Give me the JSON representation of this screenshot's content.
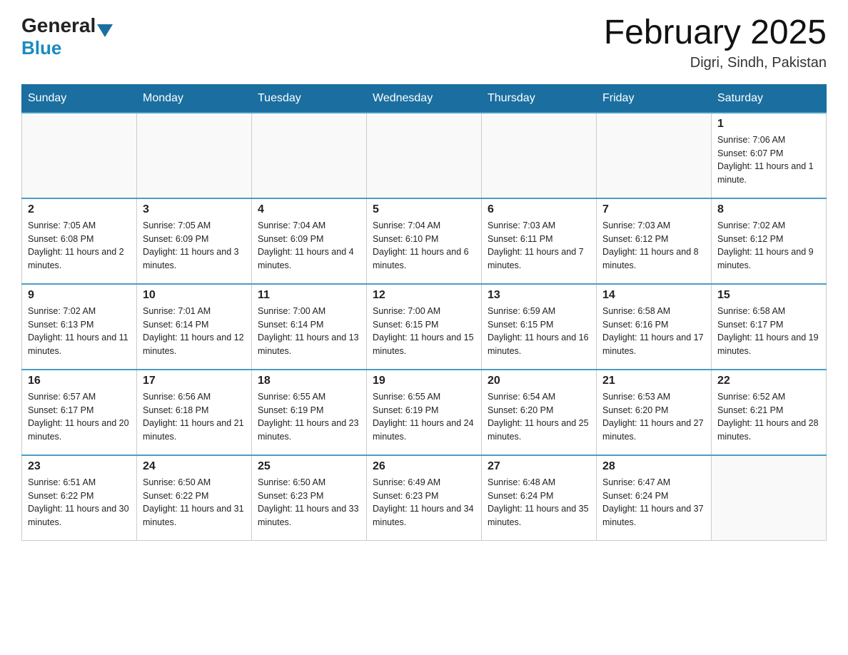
{
  "header": {
    "logo_general": "General",
    "logo_blue": "Blue",
    "month_title": "February 2025",
    "location": "Digri, Sindh, Pakistan"
  },
  "days_of_week": [
    "Sunday",
    "Monday",
    "Tuesday",
    "Wednesday",
    "Thursday",
    "Friday",
    "Saturday"
  ],
  "weeks": [
    [
      {
        "day": "",
        "info": ""
      },
      {
        "day": "",
        "info": ""
      },
      {
        "day": "",
        "info": ""
      },
      {
        "day": "",
        "info": ""
      },
      {
        "day": "",
        "info": ""
      },
      {
        "day": "",
        "info": ""
      },
      {
        "day": "1",
        "info": "Sunrise: 7:06 AM\nSunset: 6:07 PM\nDaylight: 11 hours and 1 minute."
      }
    ],
    [
      {
        "day": "2",
        "info": "Sunrise: 7:05 AM\nSunset: 6:08 PM\nDaylight: 11 hours and 2 minutes."
      },
      {
        "day": "3",
        "info": "Sunrise: 7:05 AM\nSunset: 6:09 PM\nDaylight: 11 hours and 3 minutes."
      },
      {
        "day": "4",
        "info": "Sunrise: 7:04 AM\nSunset: 6:09 PM\nDaylight: 11 hours and 4 minutes."
      },
      {
        "day": "5",
        "info": "Sunrise: 7:04 AM\nSunset: 6:10 PM\nDaylight: 11 hours and 6 minutes."
      },
      {
        "day": "6",
        "info": "Sunrise: 7:03 AM\nSunset: 6:11 PM\nDaylight: 11 hours and 7 minutes."
      },
      {
        "day": "7",
        "info": "Sunrise: 7:03 AM\nSunset: 6:12 PM\nDaylight: 11 hours and 8 minutes."
      },
      {
        "day": "8",
        "info": "Sunrise: 7:02 AM\nSunset: 6:12 PM\nDaylight: 11 hours and 9 minutes."
      }
    ],
    [
      {
        "day": "9",
        "info": "Sunrise: 7:02 AM\nSunset: 6:13 PM\nDaylight: 11 hours and 11 minutes."
      },
      {
        "day": "10",
        "info": "Sunrise: 7:01 AM\nSunset: 6:14 PM\nDaylight: 11 hours and 12 minutes."
      },
      {
        "day": "11",
        "info": "Sunrise: 7:00 AM\nSunset: 6:14 PM\nDaylight: 11 hours and 13 minutes."
      },
      {
        "day": "12",
        "info": "Sunrise: 7:00 AM\nSunset: 6:15 PM\nDaylight: 11 hours and 15 minutes."
      },
      {
        "day": "13",
        "info": "Sunrise: 6:59 AM\nSunset: 6:15 PM\nDaylight: 11 hours and 16 minutes."
      },
      {
        "day": "14",
        "info": "Sunrise: 6:58 AM\nSunset: 6:16 PM\nDaylight: 11 hours and 17 minutes."
      },
      {
        "day": "15",
        "info": "Sunrise: 6:58 AM\nSunset: 6:17 PM\nDaylight: 11 hours and 19 minutes."
      }
    ],
    [
      {
        "day": "16",
        "info": "Sunrise: 6:57 AM\nSunset: 6:17 PM\nDaylight: 11 hours and 20 minutes."
      },
      {
        "day": "17",
        "info": "Sunrise: 6:56 AM\nSunset: 6:18 PM\nDaylight: 11 hours and 21 minutes."
      },
      {
        "day": "18",
        "info": "Sunrise: 6:55 AM\nSunset: 6:19 PM\nDaylight: 11 hours and 23 minutes."
      },
      {
        "day": "19",
        "info": "Sunrise: 6:55 AM\nSunset: 6:19 PM\nDaylight: 11 hours and 24 minutes."
      },
      {
        "day": "20",
        "info": "Sunrise: 6:54 AM\nSunset: 6:20 PM\nDaylight: 11 hours and 25 minutes."
      },
      {
        "day": "21",
        "info": "Sunrise: 6:53 AM\nSunset: 6:20 PM\nDaylight: 11 hours and 27 minutes."
      },
      {
        "day": "22",
        "info": "Sunrise: 6:52 AM\nSunset: 6:21 PM\nDaylight: 11 hours and 28 minutes."
      }
    ],
    [
      {
        "day": "23",
        "info": "Sunrise: 6:51 AM\nSunset: 6:22 PM\nDaylight: 11 hours and 30 minutes."
      },
      {
        "day": "24",
        "info": "Sunrise: 6:50 AM\nSunset: 6:22 PM\nDaylight: 11 hours and 31 minutes."
      },
      {
        "day": "25",
        "info": "Sunrise: 6:50 AM\nSunset: 6:23 PM\nDaylight: 11 hours and 33 minutes."
      },
      {
        "day": "26",
        "info": "Sunrise: 6:49 AM\nSunset: 6:23 PM\nDaylight: 11 hours and 34 minutes."
      },
      {
        "day": "27",
        "info": "Sunrise: 6:48 AM\nSunset: 6:24 PM\nDaylight: 11 hours and 35 minutes."
      },
      {
        "day": "28",
        "info": "Sunrise: 6:47 AM\nSunset: 6:24 PM\nDaylight: 11 hours and 37 minutes."
      },
      {
        "day": "",
        "info": ""
      }
    ]
  ]
}
